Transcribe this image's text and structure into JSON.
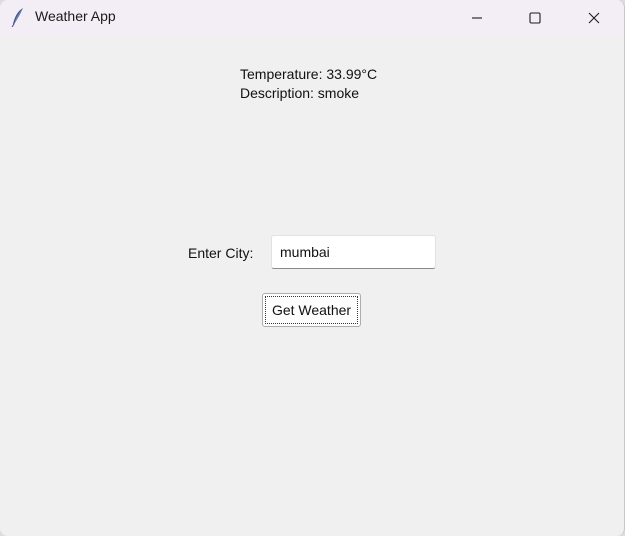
{
  "window": {
    "title": "Weather App",
    "icon": "feather-icon",
    "controls": {
      "minimize_icon": "minimize-icon",
      "maximize_icon": "maximize-icon",
      "close_icon": "close-icon"
    }
  },
  "weather": {
    "temperature_line": "Temperature: 33.99°C",
    "description_line": "Description: smoke"
  },
  "form": {
    "city_label": "Enter City:",
    "city_value": "mumbai",
    "button_label": "Get Weather"
  },
  "colors": {
    "titlebar": "#f3eef6",
    "window_bg": "#f0f0f0",
    "input_bg": "#ffffff"
  }
}
